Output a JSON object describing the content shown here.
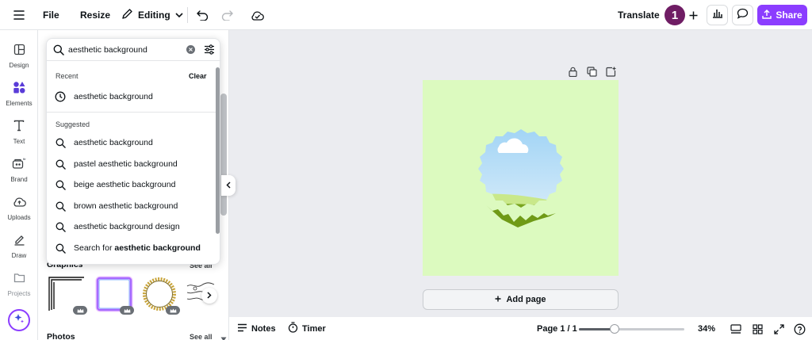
{
  "topbar": {
    "file_label": "File",
    "resize_label": "Resize",
    "mode_label": "Editing",
    "translate_label": "Translate",
    "avatar_initial": "1",
    "share_label": "Share",
    "icons": [
      "menu-icon",
      "pencil-icon",
      "chevron-down-icon",
      "undo-icon",
      "redo-icon",
      "cloud-icon",
      "plus-icon",
      "chart-icon",
      "comment-icon",
      "upload-icon"
    ]
  },
  "rail": {
    "items": [
      {
        "label": "Design",
        "icon": "layout-icon"
      },
      {
        "label": "Elements",
        "icon": "shapes-icon"
      },
      {
        "label": "Text",
        "icon": "text-icon"
      },
      {
        "label": "Brand",
        "icon": "brand-icon"
      },
      {
        "label": "Uploads",
        "icon": "cloud-upload-icon"
      },
      {
        "label": "Draw",
        "icon": "draw-icon"
      },
      {
        "label": "Projects",
        "icon": "folder-icon"
      }
    ]
  },
  "search": {
    "value": "aesthetic background",
    "recent_label": "Recent",
    "clear_label": "Clear",
    "recent": [
      "aesthetic background"
    ],
    "suggested_label": "Suggested",
    "suggested": [
      "aesthetic background",
      "pastel aesthetic background",
      "beige aesthetic background",
      "brown aesthetic background",
      "aesthetic background design"
    ],
    "search_for_prefix": "Search for ",
    "search_for_term": "aesthetic background"
  },
  "panel": {
    "graphics_title": "Graphics",
    "graphics_see_all": "See all",
    "photos_title": "Photos",
    "photos_see_all": "See all"
  },
  "canvas": {
    "background_color": "#dcfabf",
    "add_page_label": "Add page"
  },
  "bottombar": {
    "notes_label": "Notes",
    "timer_label": "Timer",
    "page_label": "Page 1 / 1",
    "zoom_label": "34%",
    "zoom_percent": 34
  },
  "colors": {
    "accent": "#8b3dff",
    "avatar": "#6f1d64"
  }
}
